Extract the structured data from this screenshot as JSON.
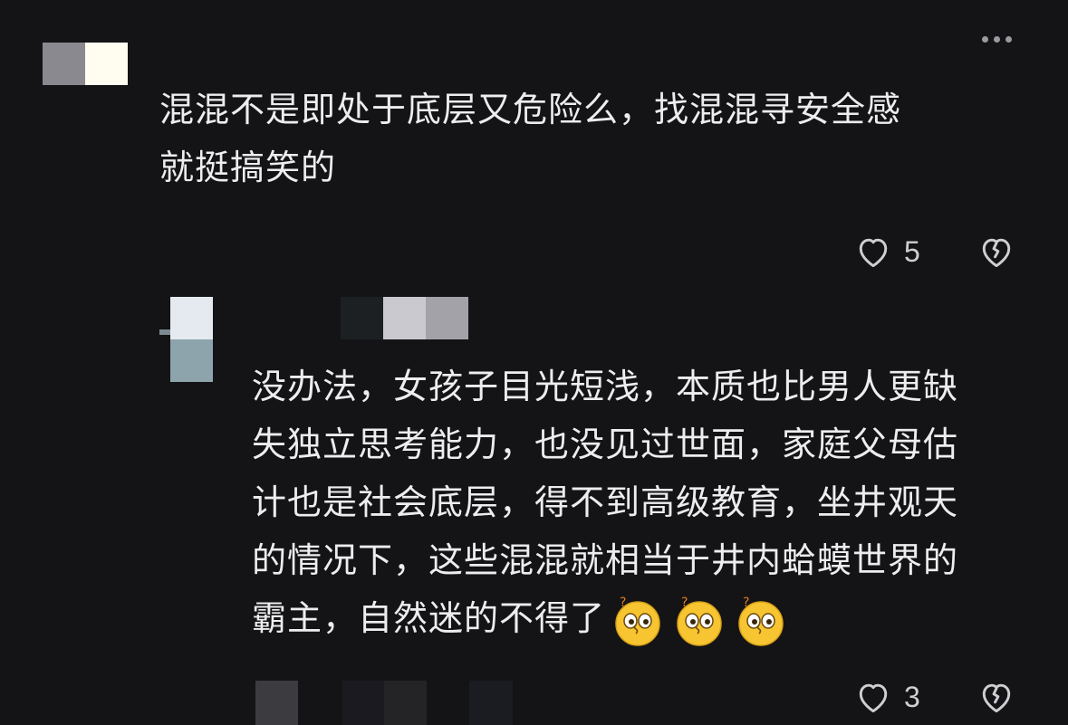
{
  "comment": {
    "text_lines": [
      "混混不是即处于底层又危险么，找混混寻安全感",
      "就挺搞笑的"
    ],
    "like_count": "5"
  },
  "reply": {
    "text_lines": [
      "没办法，女孩子目光短浅，本质也比男人更缺",
      "失独立思考能力，也没见过世面，家庭父母估",
      "计也是社会底层，得不到高级教育，坐井观天",
      "的情况下，这些混混就相当于井内蛤蟆世界的",
      "霸主，自然迷的不得了"
    ],
    "emojis": [
      "dizzy-face-emoji",
      "dizzy-face-emoji",
      "dizzy-face-emoji"
    ],
    "like_count": "3"
  },
  "icons": {
    "more": "more-options-icon",
    "like": "heart-outline-icon",
    "dislike": "broken-heart-icon"
  },
  "colors": {
    "background": "#141416",
    "text": "#ededef",
    "icon": "#cfcfd3"
  }
}
